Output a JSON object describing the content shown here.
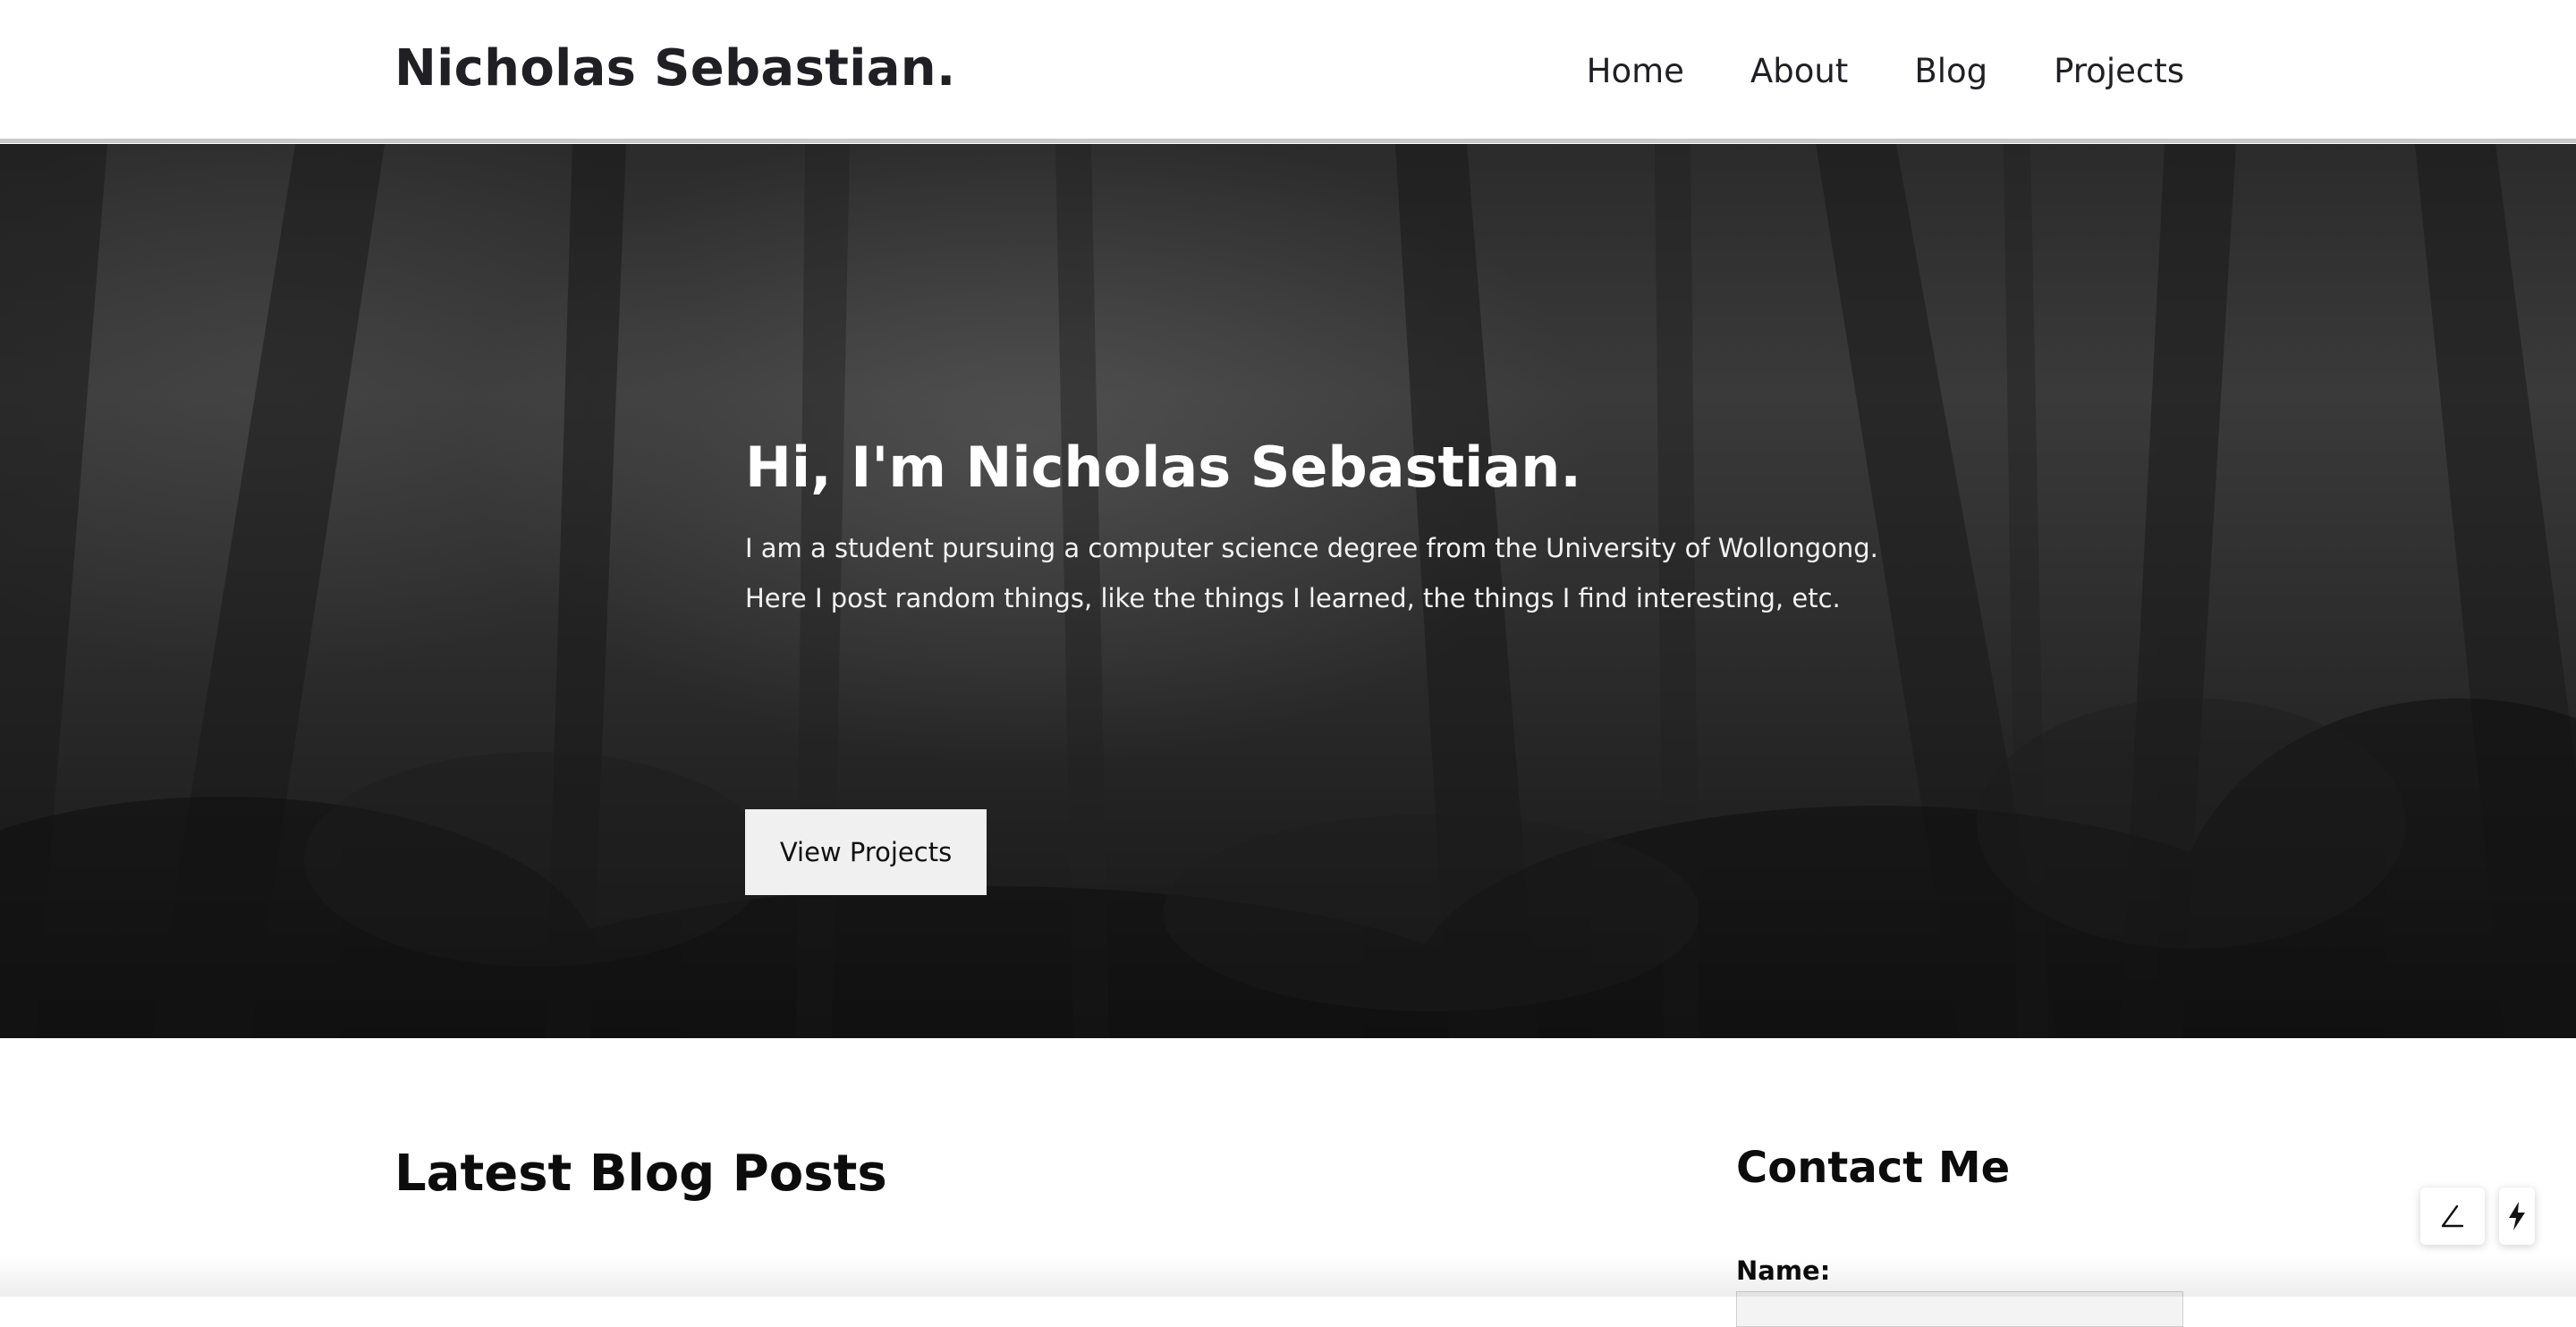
{
  "header": {
    "brand": "Nicholas Sebastian.",
    "nav": [
      "Home",
      "About",
      "Blog",
      "Projects"
    ]
  },
  "hero": {
    "title": "Hi, I'm Nicholas Sebastian.",
    "line1": "I am a student pursuing a computer science degree from the University of Wollongong.",
    "line2": "Here I post random things, like the things I learned, the things I find interesting, etc.",
    "button": "View Projects"
  },
  "blog": {
    "heading": "Latest Blog Posts"
  },
  "contact": {
    "heading": "Contact Me",
    "name_label": "Name:"
  },
  "float_tools": {
    "icons": [
      "angle-icon",
      "lightning-icon"
    ]
  }
}
